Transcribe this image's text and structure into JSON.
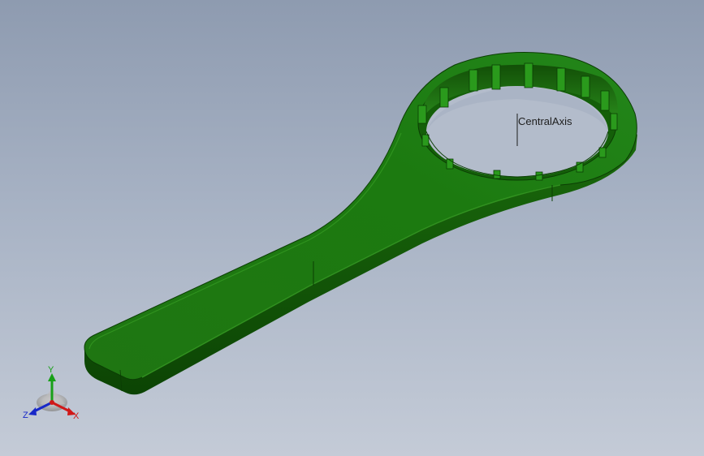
{
  "viewport": {
    "background_top": "#8e9bb0",
    "background_bottom": "#c4cbd7"
  },
  "model": {
    "part_color": "#1f7a10",
    "part_shadow_color": "#0e4a06",
    "part_highlight_color": "#3ea82a"
  },
  "reference_axis": {
    "label": "CentralAxis"
  },
  "triad": {
    "x_label": "X",
    "y_label": "Y",
    "z_label": "Z",
    "x_color": "#d01818",
    "y_color": "#18a018",
    "z_color": "#1828c8"
  }
}
